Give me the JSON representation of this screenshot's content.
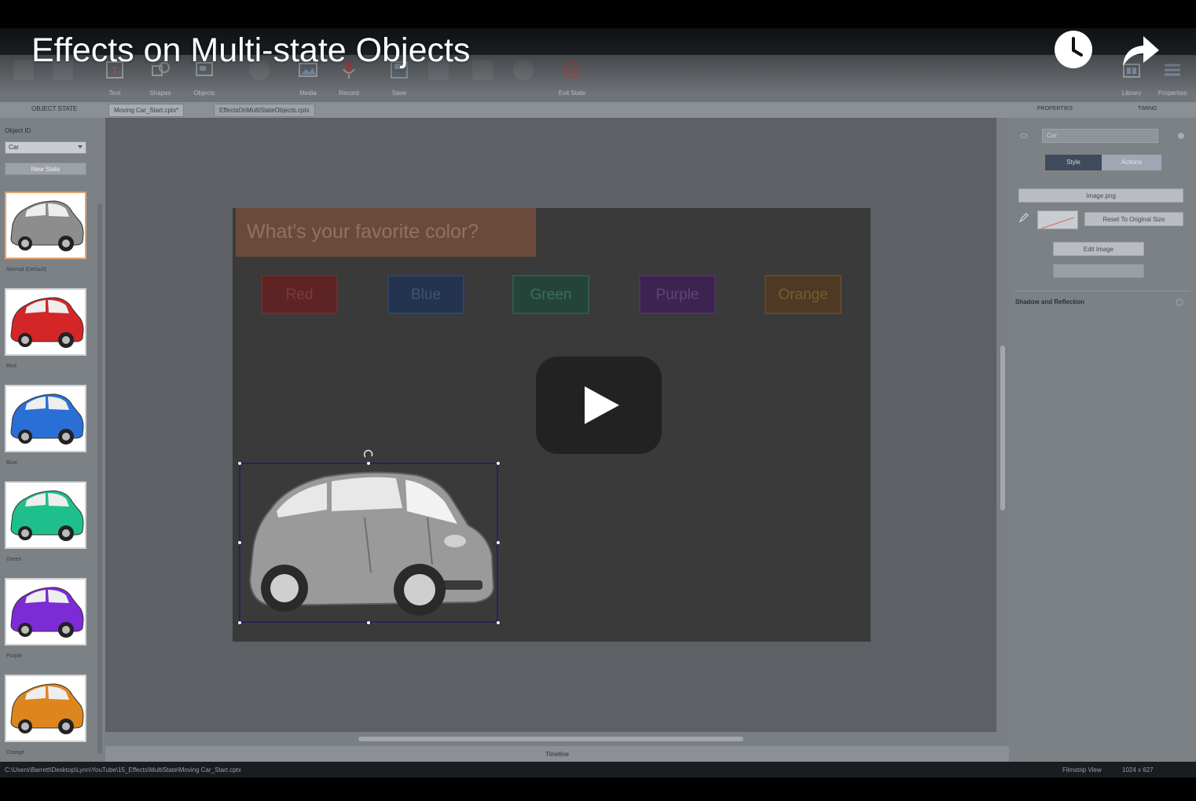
{
  "video": {
    "title": "Effects on Multi-state Objects"
  },
  "ribbon": {
    "tools": [
      {
        "label": "Text",
        "icon": "text-icon"
      },
      {
        "label": "Shapes",
        "icon": "shapes-icon"
      },
      {
        "label": "Objects",
        "icon": "objects-icon"
      },
      {
        "label": "Media",
        "icon": "media-icon"
      },
      {
        "label": "Record",
        "icon": "microphone-icon"
      },
      {
        "label": "Save",
        "icon": "save-icon"
      },
      {
        "label": "Exit State",
        "icon": "exit-state-icon"
      },
      {
        "label": "Library",
        "icon": "library-icon"
      },
      {
        "label": "Properties",
        "icon": "properties-icon"
      }
    ]
  },
  "tabs": {
    "panel_label": "OBJECT STATE",
    "doc_tabs": [
      {
        "label": "Moving Car_Start.cptx*"
      },
      {
        "label": "EffectsOnMultiStateObjects.cptx"
      }
    ]
  },
  "left_panel": {
    "object_label": "Object ID",
    "object_value": "Car",
    "new_state_label": "New State",
    "states": [
      {
        "caption": "Normal (Default)",
        "color": "#8d8d8d",
        "selected": true
      },
      {
        "caption": "Red",
        "color": "#d42626",
        "selected": false
      },
      {
        "caption": "Blue",
        "color": "#2a6fd6",
        "selected": false
      },
      {
        "caption": "Green",
        "color": "#1fbf8c",
        "selected": false
      },
      {
        "caption": "Purple",
        "color": "#7c2bd6",
        "selected": false
      },
      {
        "caption": "Orange",
        "color": "#dd861d",
        "selected": false
      }
    ]
  },
  "slide": {
    "question": "What's your favorite color?",
    "buttons": [
      {
        "label": "Red",
        "color": "#5e2424",
        "text": "#7a3a3a",
        "border": "#6b2e2e"
      },
      {
        "label": "Blue",
        "color": "#24344e",
        "text": "#3d5477",
        "border": "#2f4566"
      },
      {
        "label": "Green",
        "color": "#24443a",
        "text": "#3d6e5a",
        "border": "#2e5a4a"
      },
      {
        "label": "Purple",
        "color": "#3d2450",
        "text": "#63407e",
        "border": "#4e3266"
      },
      {
        "label": "Orange",
        "color": "#4e3a22",
        "text": "#7a5a30",
        "border": "#63482a"
      }
    ]
  },
  "timeline": {
    "label": "Timeline"
  },
  "right_panel": {
    "tabs": [
      "PROPERTIES",
      "TIMING"
    ],
    "name_value": "Car",
    "segment_on": "Style",
    "segment_off": "Actions",
    "image_label": "Image.png",
    "reset_label": "Reset To Original Size",
    "edit_label": "Edit Image",
    "section_label": "Shadow and Reflection"
  },
  "status": {
    "path": "C:\\Users\\Barrett\\Desktop\\Lynn\\YouTube\\15_Effects\\MultiState\\Moving Car_Start.cptx",
    "view": "Filmstrip View",
    "size": "1024 x 627"
  }
}
